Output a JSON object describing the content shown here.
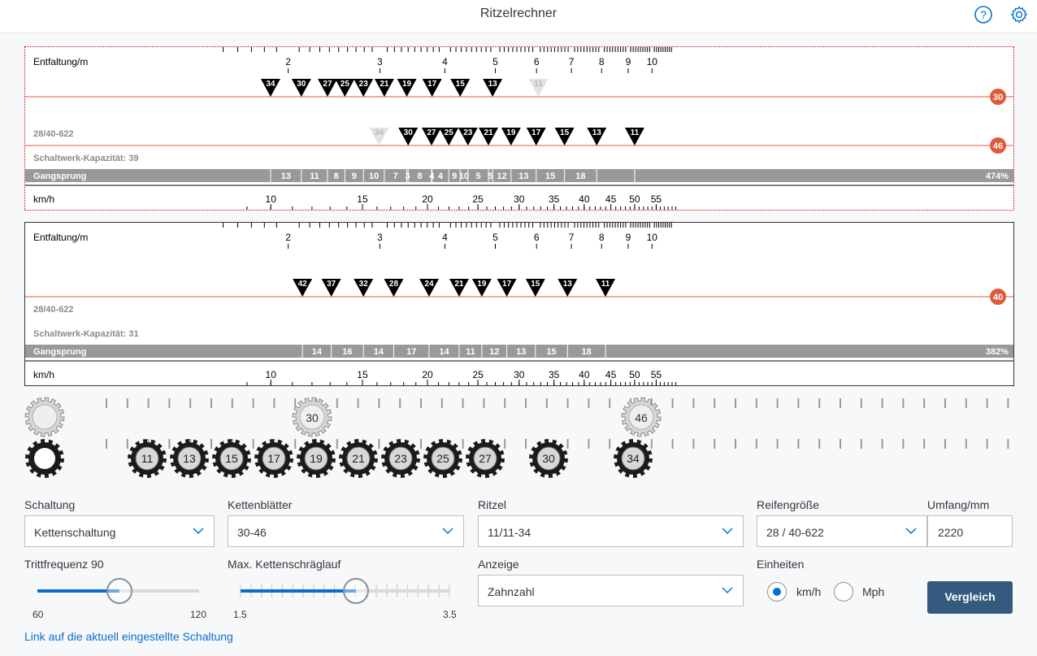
{
  "header": {
    "title": "Ritzelrechner"
  },
  "panel1": {
    "label_top": "Entfaltung/m",
    "label_bottom": "km/h",
    "tire": "28/40-622",
    "capacity": "Schaltwerk-Kapazität: 39",
    "gangsprung_label": "Gangsprung",
    "top_ticks": [
      {
        "v": 2,
        "label": "2"
      },
      {
        "v": 3,
        "label": "3"
      },
      {
        "v": 4,
        "label": "4"
      },
      {
        "v": 5,
        "label": "5"
      },
      {
        "v": 6,
        "label": "6"
      },
      {
        "v": 7,
        "label": "7"
      },
      {
        "v": 8,
        "label": "8"
      },
      {
        "v": 9,
        "label": "9"
      },
      {
        "v": 10,
        "label": "10"
      }
    ],
    "bottom_ticks": [
      {
        "v": 10,
        "label": "10"
      },
      {
        "v": 15,
        "label": "15"
      },
      {
        "v": 20,
        "label": "20"
      },
      {
        "v": 25,
        "label": "25"
      },
      {
        "v": 30,
        "label": "30"
      },
      {
        "v": 35,
        "label": "35"
      },
      {
        "v": 40,
        "label": "40"
      },
      {
        "v": 45,
        "label": "45"
      },
      {
        "v": 50,
        "label": "50"
      },
      {
        "v": 55,
        "label": "55"
      }
    ],
    "rows": [
      {
        "chainring": "30",
        "markers": [
          {
            "z": "34",
            "v": 1.85,
            "grey": false
          },
          {
            "z": "30",
            "v": 2.12,
            "grey": false
          },
          {
            "z": "27",
            "v": 2.38,
            "grey": false
          },
          {
            "z": "25",
            "v": 2.57,
            "grey": false
          },
          {
            "z": "23",
            "v": 2.79,
            "grey": false
          },
          {
            "z": "21",
            "v": 3.06,
            "grey": false
          },
          {
            "z": "19",
            "v": 3.38,
            "grey": false
          },
          {
            "z": "17",
            "v": 3.78,
            "grey": false
          },
          {
            "z": "15",
            "v": 4.28,
            "grey": false
          },
          {
            "z": "13",
            "v": 4.94,
            "grey": false
          },
          {
            "z": "11",
            "v": 6.05,
            "grey": true
          }
        ]
      },
      {
        "chainring": "46",
        "markers": [
          {
            "z": "34",
            "v": 2.99,
            "grey": true
          },
          {
            "z": "30",
            "v": 3.4,
            "grey": false
          },
          {
            "z": "27",
            "v": 3.77,
            "grey": false
          },
          {
            "z": "25",
            "v": 4.07,
            "grey": false
          },
          {
            "z": "23",
            "v": 4.43,
            "grey": false
          },
          {
            "z": "21",
            "v": 4.85,
            "grey": false
          },
          {
            "z": "19",
            "v": 5.36,
            "grey": false
          },
          {
            "z": "17",
            "v": 5.99,
            "grey": false
          },
          {
            "z": "15",
            "v": 6.79,
            "grey": false
          },
          {
            "z": "13",
            "v": 7.83,
            "grey": false
          },
          {
            "z": "11",
            "v": 9.26,
            "grey": false
          }
        ]
      }
    ],
    "gangsprung": [
      "13",
      "11",
      "8",
      "9",
      "10",
      "7",
      "3",
      "8",
      "4",
      "4",
      "9",
      "10",
      "5",
      "5",
      "12",
      "13",
      "15",
      "18"
    ],
    "gangsprung_total": "474%"
  },
  "panel2": {
    "label_top": "Entfaltung/m",
    "label_bottom": "km/h",
    "tire": "28/40-622",
    "capacity": "Schaltwerk-Kapazität: 31",
    "gangsprung_label": "Gangsprung",
    "rows": [
      {
        "chainring": "40",
        "markers": [
          {
            "z": "42",
            "v": 2.13,
            "grey": false
          },
          {
            "z": "37",
            "v": 2.42,
            "grey": false
          },
          {
            "z": "32",
            "v": 2.79,
            "grey": false
          },
          {
            "z": "28",
            "v": 3.19,
            "grey": false
          },
          {
            "z": "24",
            "v": 3.73,
            "grey": false
          },
          {
            "z": "21",
            "v": 4.26,
            "grey": false
          },
          {
            "z": "19",
            "v": 4.71,
            "grey": false
          },
          {
            "z": "17",
            "v": 5.26,
            "grey": false
          },
          {
            "z": "15",
            "v": 5.97,
            "grey": false
          },
          {
            "z": "13",
            "v": 6.88,
            "grey": false
          },
          {
            "z": "11",
            "v": 8.14,
            "grey": false
          }
        ]
      }
    ],
    "gangsprung": [
      "14",
      "16",
      "14",
      "17",
      "14",
      "11",
      "12",
      "13",
      "15",
      "18"
    ],
    "gangsprung_total": "382%"
  },
  "gears": {
    "chainrings": [
      "30",
      "46"
    ],
    "sprockets": [
      "11",
      "13",
      "15",
      "17",
      "19",
      "21",
      "23",
      "25",
      "27",
      "30",
      "34"
    ]
  },
  "form": {
    "schaltung": {
      "label": "Schaltung",
      "value": "Kettenschaltung"
    },
    "kettenblaetter": {
      "label": "Kettenblätter",
      "value": "30-46"
    },
    "ritzel": {
      "label": "Ritzel",
      "value": "11/11-34"
    },
    "reifen": {
      "label": "Reifengröße",
      "value": "28 / 40-622"
    },
    "umfang": {
      "label": "Umfang/mm",
      "value": "2220"
    },
    "trittfrequenz": {
      "label": "Trittfrequenz 90",
      "min": "60",
      "max": "120",
      "value": 90
    },
    "schraeglauf": {
      "label": "Max. Kettenschräglauf",
      "min": "1.5",
      "max": "3.5",
      "value": 2.5
    },
    "anzeige": {
      "label": "Anzeige",
      "value": "Zahnzahl"
    },
    "einheiten": {
      "label": "Einheiten",
      "opt1": "km/h",
      "opt2": "Mph",
      "selected": "km/h"
    },
    "vergleich": "Vergleich",
    "link": "Link auf die aktuell eingestellte Schaltung"
  },
  "colors": {
    "accent": "#0a6ed1",
    "chainline": "#e05a3a",
    "button": "#345b7f",
    "gangsprung_bar": "#999999"
  }
}
